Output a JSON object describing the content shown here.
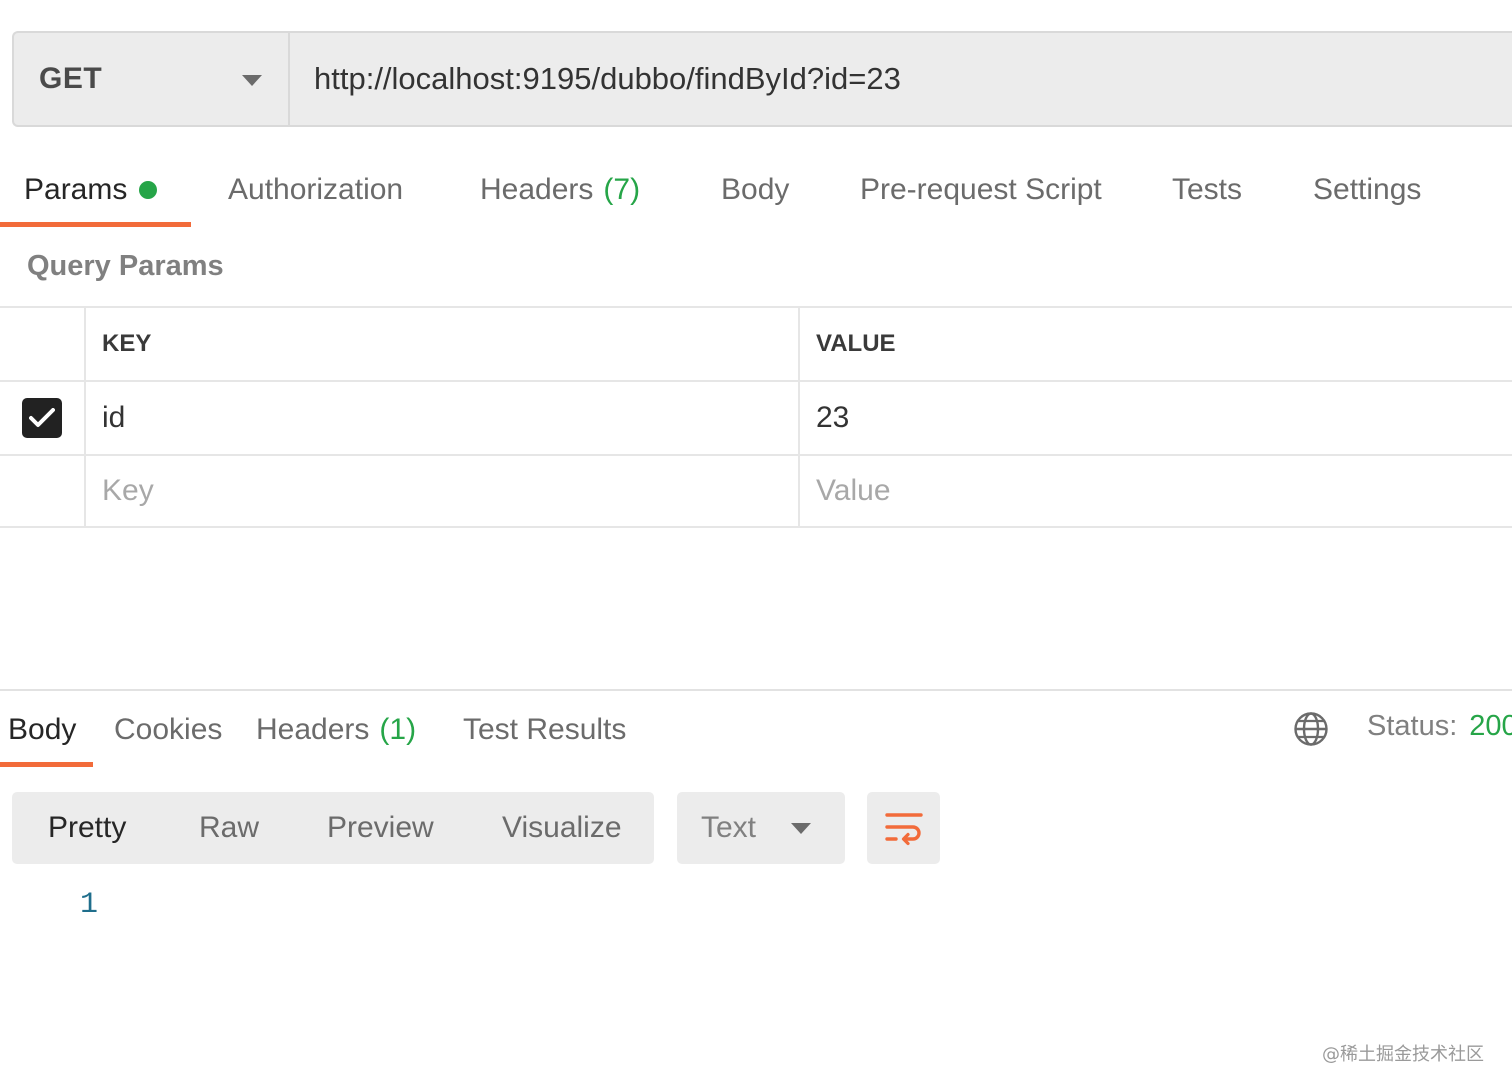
{
  "request": {
    "method": "GET",
    "url": "http://localhost:9195/dubbo/findById?id=23"
  },
  "request_tabs": [
    {
      "label": "Params",
      "active": true,
      "indicator": "green-dot"
    },
    {
      "label": "Authorization"
    },
    {
      "label": "Headers",
      "count": "(7)"
    },
    {
      "label": "Body"
    },
    {
      "label": "Pre-request Script"
    },
    {
      "label": "Tests"
    },
    {
      "label": "Settings"
    }
  ],
  "query_params": {
    "title": "Query Params",
    "columns": [
      "KEY",
      "VALUE"
    ],
    "rows": [
      {
        "checked": true,
        "key": "id",
        "value": "23"
      }
    ],
    "placeholder": {
      "key": "Key",
      "value": "Value"
    }
  },
  "response_tabs": [
    {
      "label": "Body",
      "active": true
    },
    {
      "label": "Cookies"
    },
    {
      "label": "Headers",
      "count": "(1)"
    },
    {
      "label": "Test Results"
    }
  ],
  "status": {
    "label": "Status:",
    "value": "200"
  },
  "body_views": [
    {
      "label": "Pretty",
      "active": true
    },
    {
      "label": "Raw"
    },
    {
      "label": "Preview"
    },
    {
      "label": "Visualize"
    }
  ],
  "format": {
    "selected": "Text"
  },
  "code": {
    "line_numbers": [
      "1"
    ]
  },
  "watermark": "@稀土掘金技术社区",
  "colors": {
    "accent": "#f26b3a",
    "success": "#26a548",
    "line_number": "#1f6e8c"
  },
  "icons": [
    "chevron-down-icon",
    "checkmark-icon",
    "globe-icon",
    "wrap-lines-icon"
  ]
}
